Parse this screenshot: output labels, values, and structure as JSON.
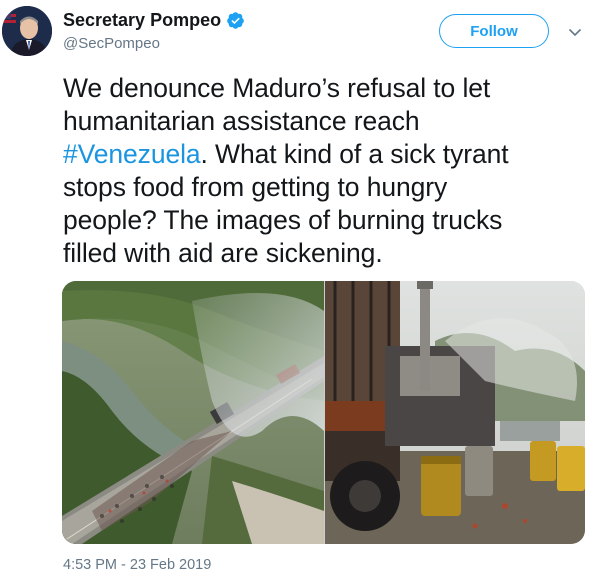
{
  "author": {
    "name": "Secretary Pompeo",
    "handle": "@SecPompeo",
    "verified_icon": "verified-badge-icon",
    "avatar_icon": "profile-photo"
  },
  "actions": {
    "follow_label": "Follow",
    "menu_icon": "chevron-down-icon"
  },
  "tweet": {
    "line1": "We denounce Maduro’s refusal to let",
    "line2": "humanitarian assistance reach",
    "hashtag": "#Venezuela",
    "line3_rest": ". What kind of a sick tyrant",
    "line4": "stops food from getting to hungry",
    "line5": "people? The images of burning trucks",
    "line6": "filled with aid are sickening."
  },
  "media": {
    "photos": [
      {
        "name": "bridge-aerial-photo"
      },
      {
        "name": "burned-truck-photo"
      }
    ]
  },
  "timestamp": "4:53 PM - 23 Feb 2019",
  "colors": {
    "link": "#1b95e0",
    "follow_blue": "#1da1f2",
    "secondary_text": "#657786",
    "primary_text": "#14171a"
  }
}
